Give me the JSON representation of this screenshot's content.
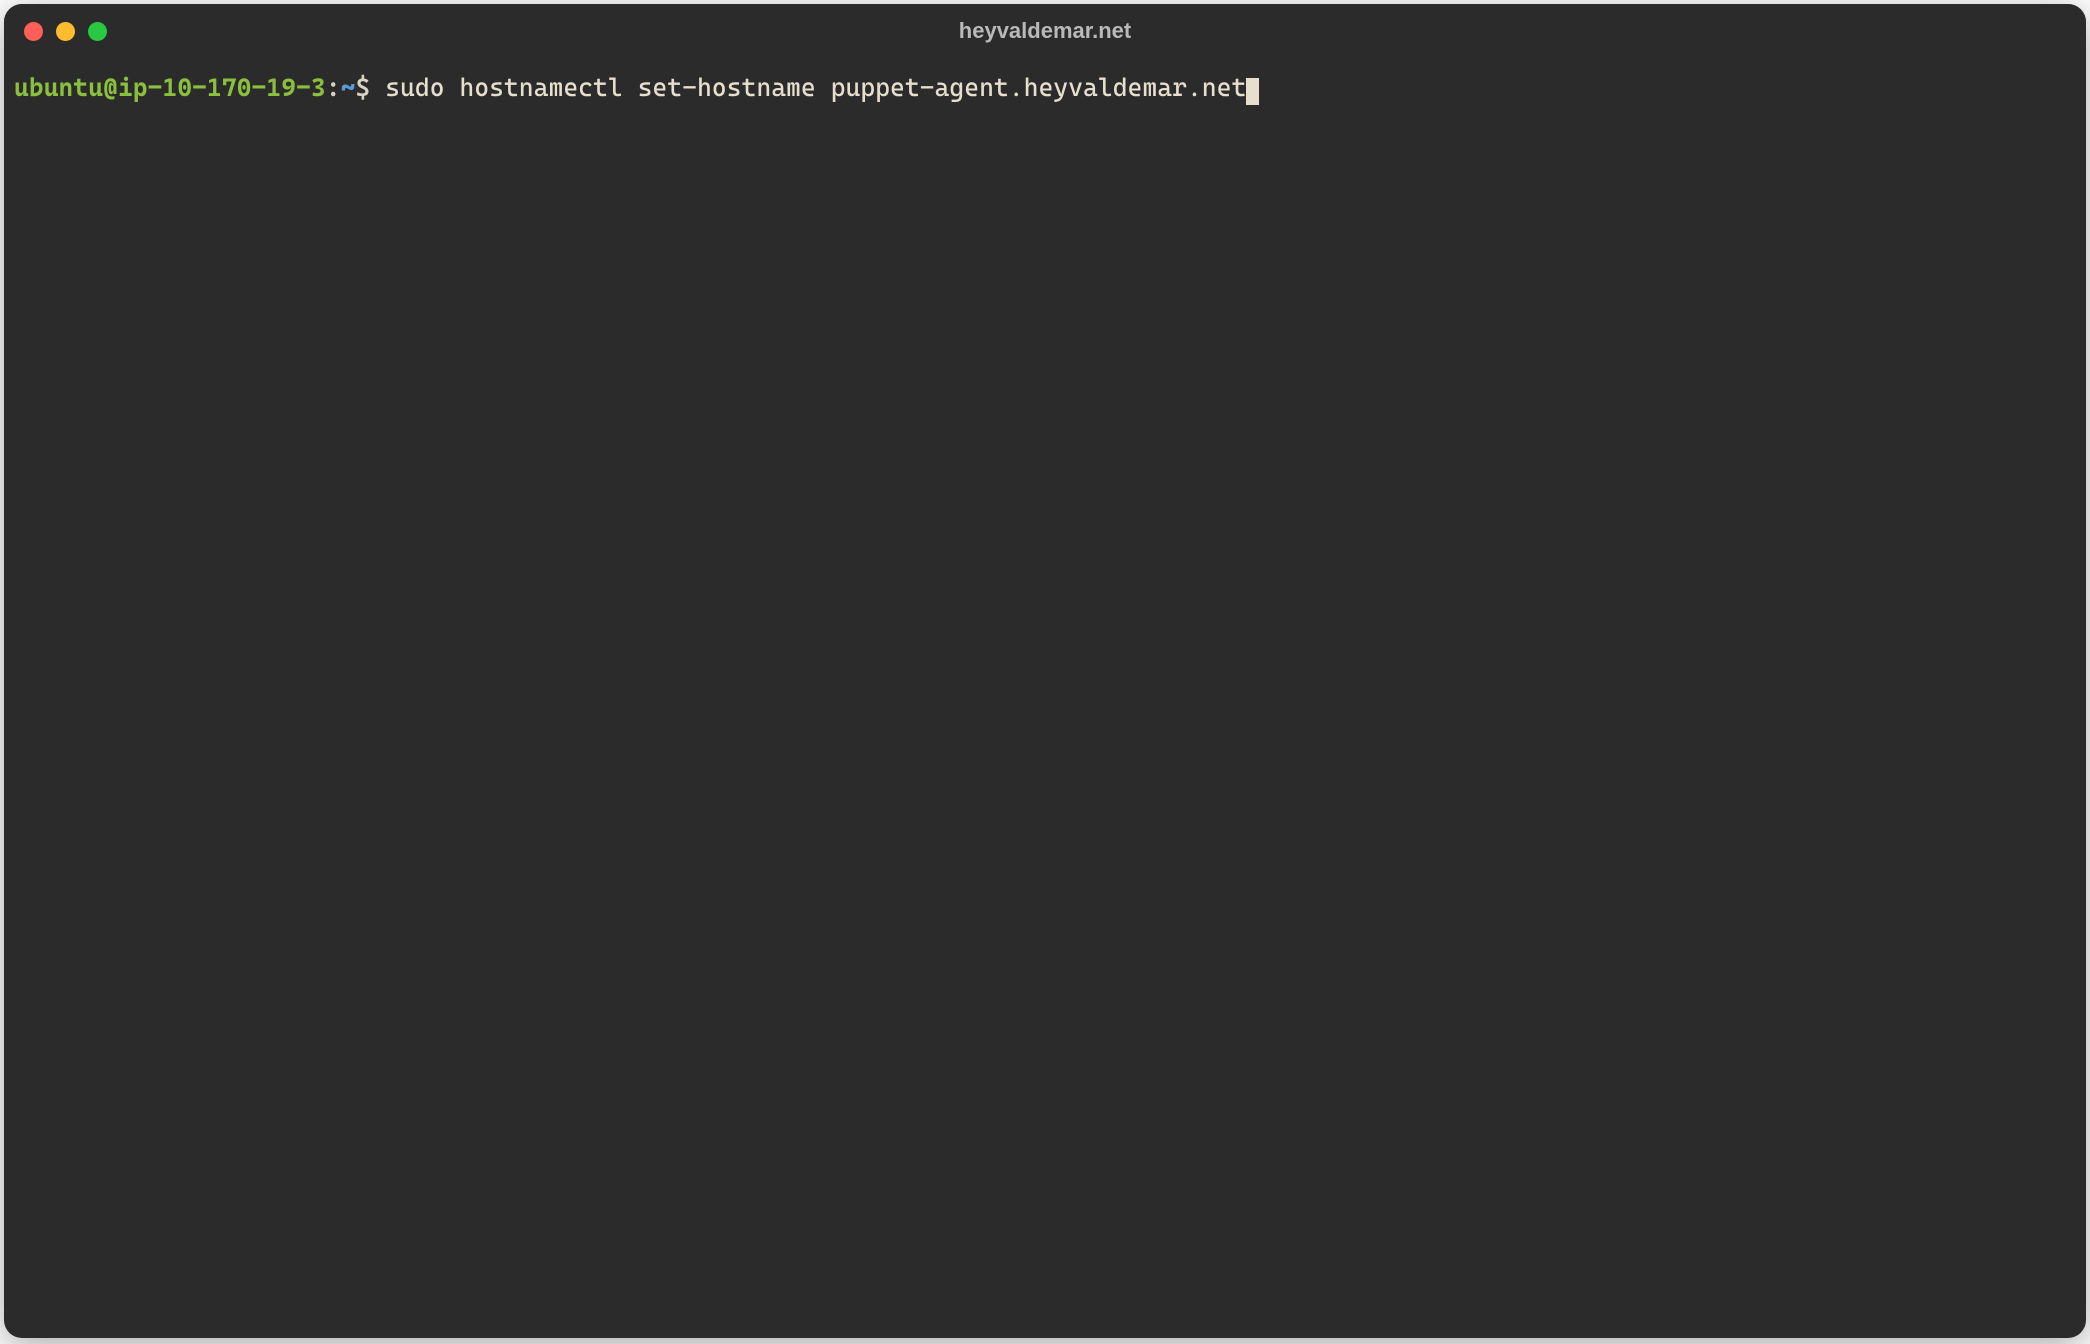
{
  "titlebar": {
    "title": "heyvaldemar.net"
  },
  "prompt": {
    "user_host": "ubuntu@ip-10-170-19-3",
    "separator": ":",
    "path": "~",
    "symbol": "$"
  },
  "command": "sudo hostnamectl set-hostname puppet-agent.heyvaldemar.net",
  "colors": {
    "background": "#2b2b2b",
    "prompt_user": "#8bbf3e",
    "prompt_path": "#5a9bd4",
    "text": "#e6dfce",
    "title_text": "#b9b9b9",
    "traffic_close": "#ff5f57",
    "traffic_min": "#febc2e",
    "traffic_max": "#28c840"
  }
}
